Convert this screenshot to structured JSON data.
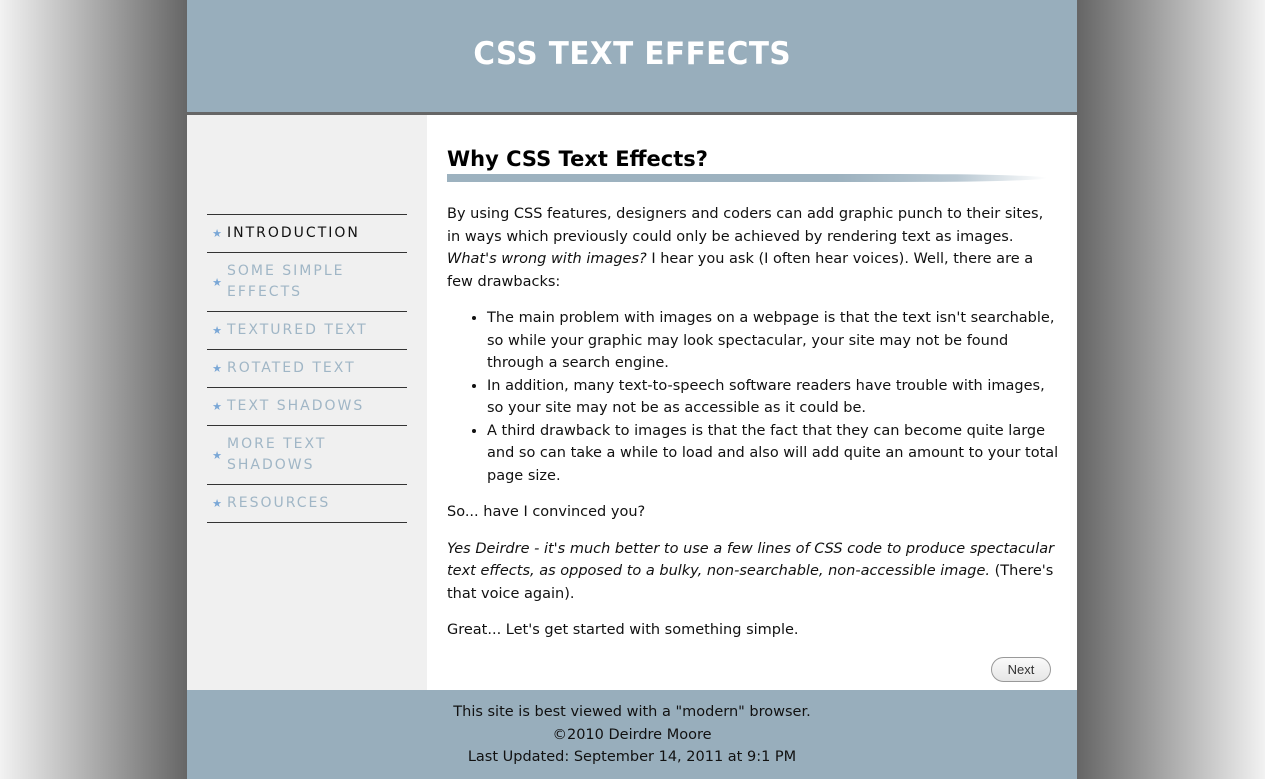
{
  "header": {
    "title": "CSS TEXT EFFECTS"
  },
  "sidebar": {
    "items": [
      {
        "label": "INTRODUCTION",
        "active": true
      },
      {
        "label": "SOME SIMPLE EFFECTS",
        "active": false
      },
      {
        "label": "TEXTURED TEXT",
        "active": false
      },
      {
        "label": "ROTATED TEXT",
        "active": false
      },
      {
        "label": "TEXT SHADOWS",
        "active": false
      },
      {
        "label": "MORE TEXT SHADOWS",
        "active": false
      },
      {
        "label": "RESOURCES",
        "active": false
      }
    ],
    "bullet_icon": "star-icon",
    "bullet_glyph": "★"
  },
  "main": {
    "heading": "Why CSS Text Effects?",
    "intro": {
      "part1": "By using CSS features, designers and coders can add graphic punch to their sites, in ways which previously could only be achieved by rendering text as images. ",
      "italic": "What's wrong with images?",
      "part2": " I hear you ask (I often hear voices). Well, there are a few drawbacks:"
    },
    "drawbacks": [
      "The main problem with images on a webpage is that the text isn't searchable, so while your graphic may look spectacular, your site may not be found through a search engine.",
      "In addition, many text-to-speech software readers have trouble with images, so your site may not be as accessible as it could be.",
      "A third drawback to images is that the fact that they can become quite large and so can take a while to load and also will add quite an amount to your total page size."
    ],
    "question": "So... have I convinced you?",
    "answer": {
      "italic": "Yes Deirdre - it's much better to use a few lines of CSS code to produce spectacular text effects, as opposed to a bulky, non-searchable, non-accessible image.",
      "plain": " (There's that voice again)."
    },
    "closing": "Great... Let's get started with something simple.",
    "next_label": "Next"
  },
  "footer": {
    "line1": "This site is best viewed with a \"modern\" browser.",
    "line2": "©2010 Deirdre Moore",
    "line3": "Last Updated: September 14, 2011 at 9:1 PM"
  },
  "colors": {
    "header_bg": "#98aebc",
    "nav_inactive": "#a0b6c6",
    "nav_star": "#7aa7d6",
    "sidebar_bg": "#f0f0f0"
  }
}
